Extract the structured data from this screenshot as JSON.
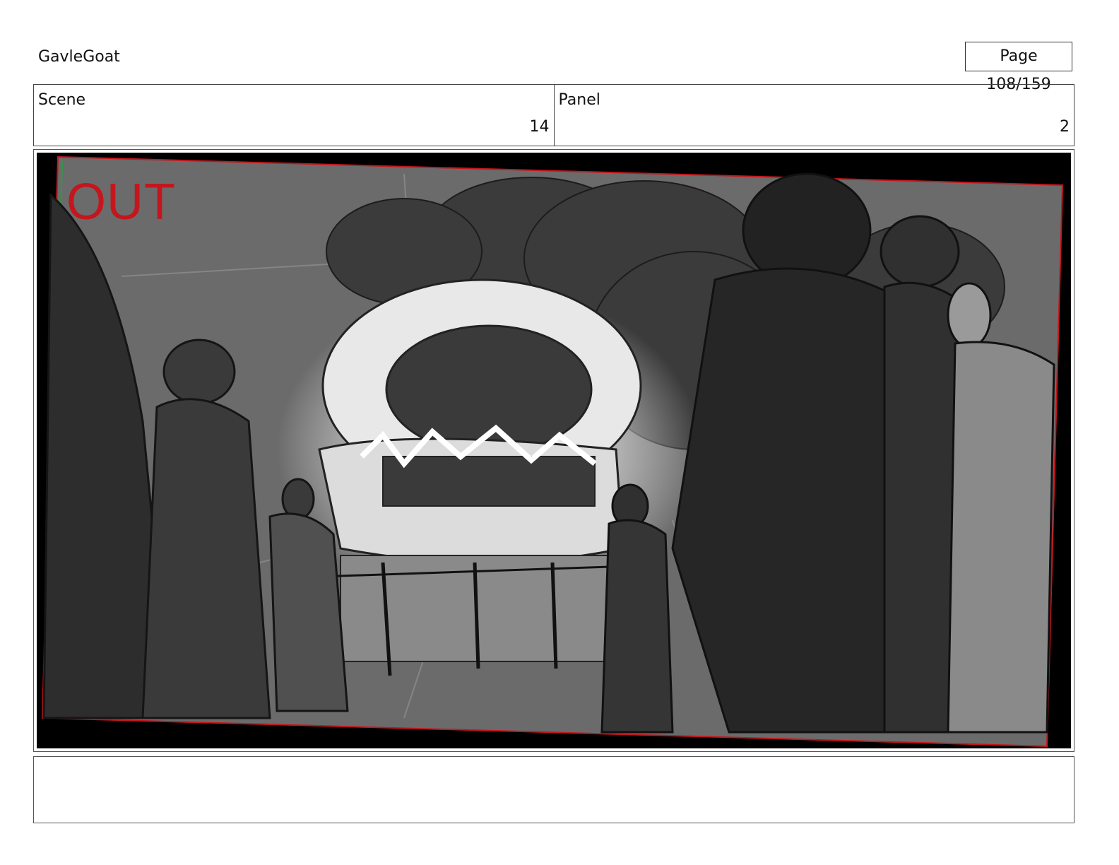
{
  "header": {
    "project_title": "GavleGoat",
    "page_indicator": "Page 108/159"
  },
  "info": {
    "scene_label": "Scene",
    "scene_value": "14",
    "panel_label": "Panel",
    "panel_value": "2"
  },
  "panel": {
    "overlay_text": "OUT",
    "guide_colors": {
      "frame": "#c4161c",
      "safe": "#1fa33a"
    }
  },
  "notes": {
    "text": ""
  }
}
